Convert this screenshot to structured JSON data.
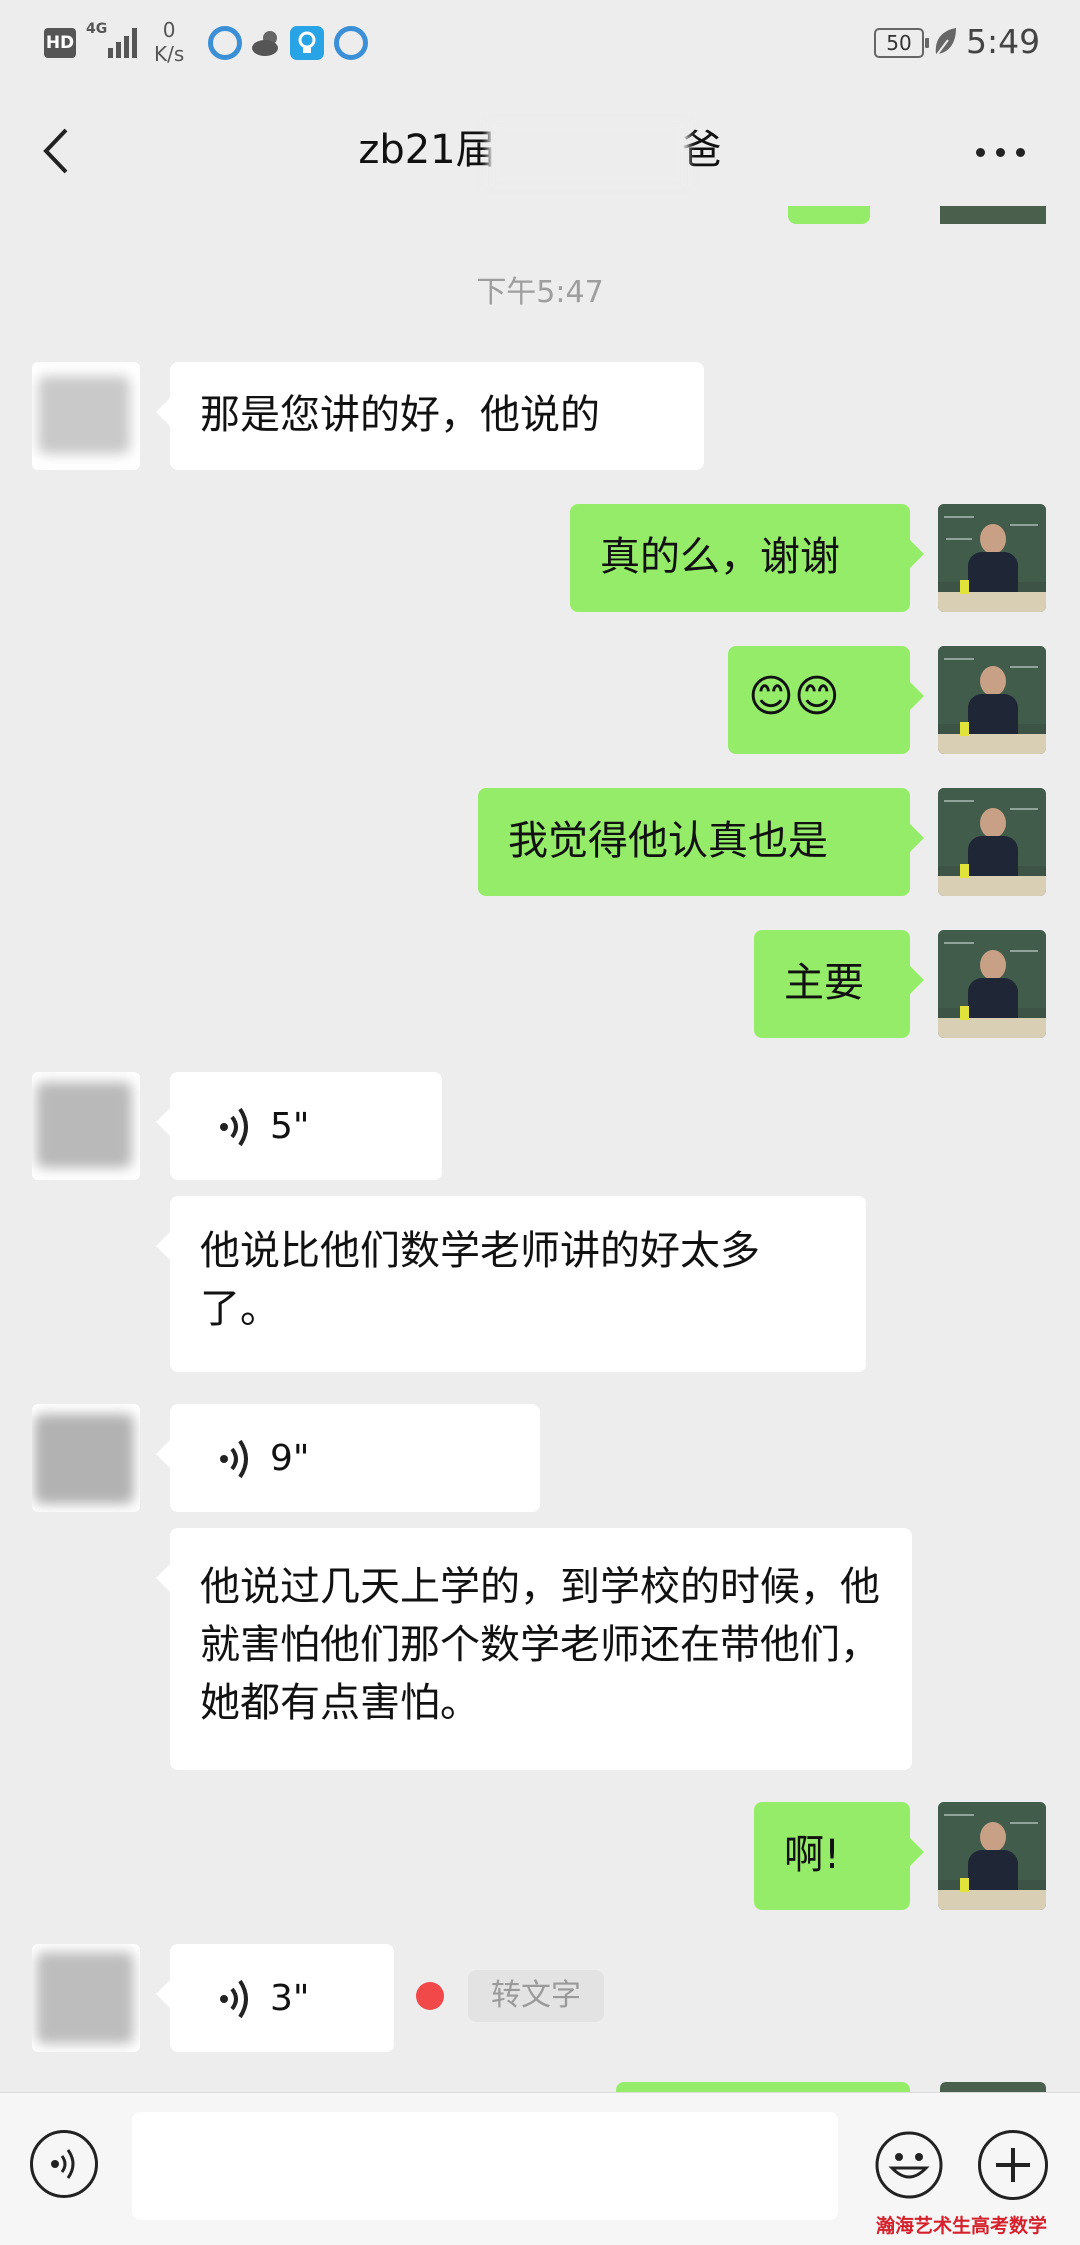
{
  "status_bar": {
    "hd": "HD",
    "network": "4G",
    "speed_value": "0",
    "speed_unit": "K/s",
    "battery": "50",
    "time": "5:49"
  },
  "header": {
    "back_icon": "chevron-left-icon",
    "title": "zb21届",
    "title_suffix": "爸",
    "more_icon": "more-icon"
  },
  "chat": {
    "timestamp": "下午5:47",
    "messages": [
      {
        "from": "other",
        "type": "text",
        "text": "那是您讲的好，他说的"
      },
      {
        "from": "me",
        "type": "text",
        "text": "真的么，谢谢"
      },
      {
        "from": "me",
        "type": "emoji",
        "text": "😊😊"
      },
      {
        "from": "me",
        "type": "text",
        "text": "我觉得他认真也是"
      },
      {
        "from": "me",
        "type": "text",
        "text": "主要"
      },
      {
        "from": "other",
        "type": "voice",
        "duration": "5\""
      },
      {
        "from": "other",
        "type": "text",
        "text": "他说比他们数学老师讲的好太多了。"
      },
      {
        "from": "other",
        "type": "voice",
        "duration": "9\""
      },
      {
        "from": "other",
        "type": "text",
        "text": "他说过几天上学的，到学校的时候，他就害怕他们那个数学老师还在带他们，她都有点害怕。"
      },
      {
        "from": "me",
        "type": "text",
        "text": "啊!"
      },
      {
        "from": "other",
        "type": "voice",
        "duration": "3\"",
        "transcribe": "转文字"
      }
    ]
  },
  "bottom_bar": {
    "voice_icon": "voice-input-icon",
    "emoji_icon": "emoji-icon",
    "plus_icon": "plus-icon"
  },
  "watermark": "瀚海艺术生高考数学"
}
